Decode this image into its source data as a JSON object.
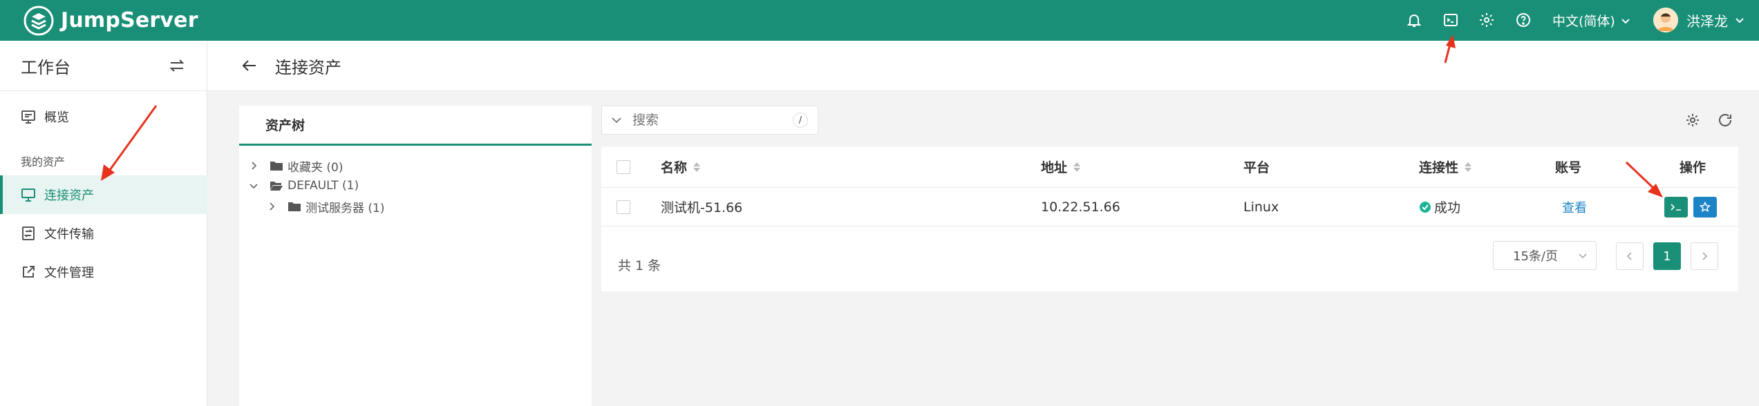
{
  "app": {
    "name": "JumpServer"
  },
  "topbar": {
    "language": "中文(简体)",
    "username": "洪泽龙",
    "icons": [
      "bell-icon",
      "terminal-icon",
      "gear-icon",
      "help-icon"
    ]
  },
  "sidebar": {
    "title": "工作台",
    "group_label": "我的资产",
    "items": [
      {
        "label": "概览",
        "icon": "monitor-icon"
      },
      {
        "label": "连接资产",
        "icon": "desktop-icon",
        "active": true
      },
      {
        "label": "文件传输",
        "icon": "file-transfer-icon"
      },
      {
        "label": "文件管理",
        "icon": "external-link-icon"
      }
    ]
  },
  "page": {
    "title": "连接资产"
  },
  "tree": {
    "tab_label": "资产树",
    "nodes": [
      {
        "label": "收藏夹 (0)"
      },
      {
        "label": "DEFAULT (1)"
      },
      {
        "label": "测试服务器 (1)"
      }
    ]
  },
  "search": {
    "placeholder": "搜索",
    "shortcut": "/"
  },
  "table": {
    "columns": [
      "名称",
      "地址",
      "平台",
      "连接性",
      "账号",
      "操作"
    ],
    "rows": [
      {
        "name": "测试机-51.66",
        "address": "10.22.51.66",
        "platform": "Linux",
        "connectivity": "成功",
        "account": "查看"
      }
    ]
  },
  "pagination": {
    "total": "共 1 条",
    "page_size": "15条/页",
    "current_page": "1"
  },
  "colors": {
    "brand": "#1a8f77",
    "link": "#1c84c6",
    "success": "#1ab394"
  }
}
